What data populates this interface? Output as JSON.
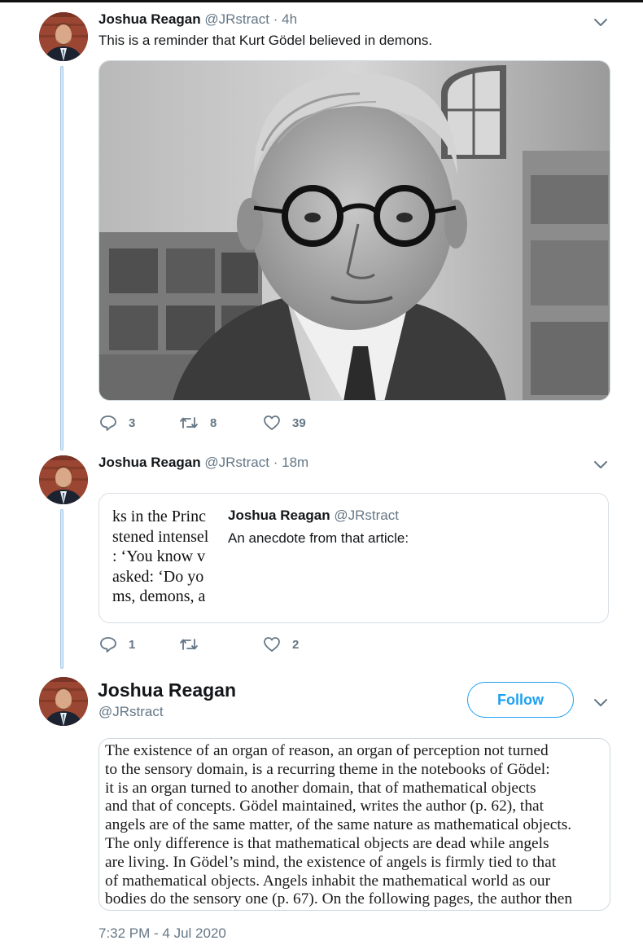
{
  "tweets": [
    {
      "author": {
        "name": "Joshua Reagan",
        "handle": "@JRstract"
      },
      "sep": "·",
      "time": "4h",
      "text": "This is a reminder that Kurt Gödel believed in demons.",
      "actions": {
        "replies": "3",
        "retweets": "8",
        "likes": "39"
      }
    },
    {
      "author": {
        "name": "Joshua Reagan",
        "handle": "@JRstract"
      },
      "sep": "·",
      "time": "18m",
      "quoted": {
        "author": {
          "name": "Joshua Reagan",
          "handle": "@JRstract"
        },
        "text": "An anecdote from that article:",
        "thumbnail_lines": [
          "ks in the Princ",
          "stened intensel",
          ": ‘You know v",
          "asked: ‘Do yo",
          "ms, demons, a"
        ]
      },
      "actions": {
        "replies": "1",
        "retweets": "",
        "likes": "2"
      }
    },
    {
      "author": {
        "name": "Joshua Reagan",
        "handle": "@JRstract"
      },
      "follow_label": "Follow",
      "excerpt_lines": [
        "The existence of an organ of reason, an organ of perception not turned",
        "to the sensory domain, is a recurring theme in the notebooks of Gödel:",
        "it is an organ turned to another domain, that of mathematical objects",
        "and that of concepts. Gödel maintained, writes the author (p. 62), that",
        "angels are of the same matter, of the same nature as mathematical objects.",
        "The only difference is that mathematical objects are dead while angels",
        "are living. In Gödel’s mind, the existence of angels is firmly tied to that",
        "of mathematical objects. Angels inhabit the mathematical world as our",
        "bodies do the sensory one (p. 67). On the following pages, the author then"
      ],
      "timestamp": "7:32 PM - 4 Jul 2020"
    }
  ],
  "icons": {
    "reply": "reply-icon",
    "retweet": "retweet-icon",
    "like": "heart-icon",
    "menu": "chevron-down-icon"
  },
  "colors": {
    "accent": "#1da1f2",
    "secondary_text": "#657786",
    "thread_line": "#a9c9ea"
  }
}
